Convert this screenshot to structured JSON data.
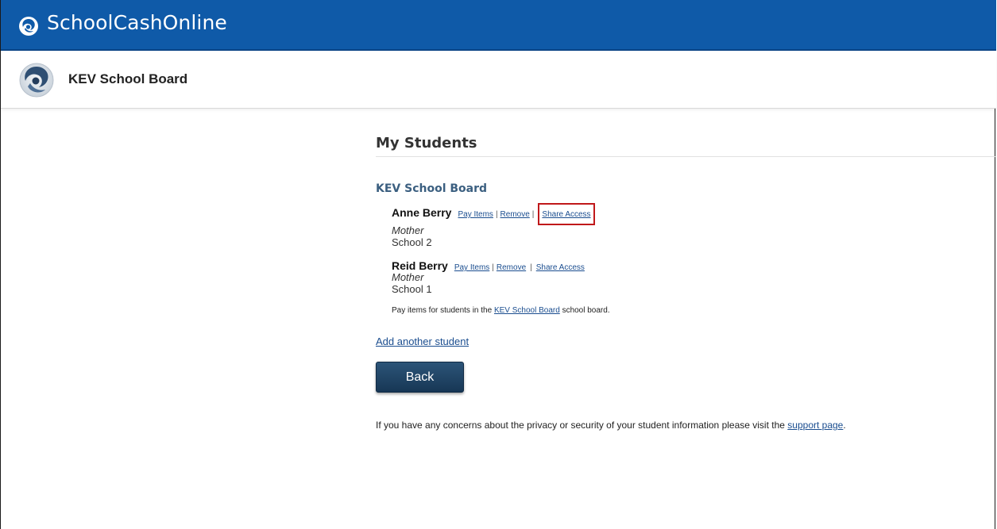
{
  "header": {
    "app_name": "SchoolCashOnline",
    "brand_color": "#0f5aa8",
    "logo_icon": "schoolcash-swirl-icon"
  },
  "board_bar": {
    "name": "KEV School Board",
    "logo_icon": "board-swirl-icon"
  },
  "main": {
    "title": "My Students",
    "section_title": "KEV School Board",
    "students": [
      {
        "name": "Anne Berry",
        "links": {
          "pay": "Pay Items",
          "remove": "Remove",
          "share": "Share Access"
        },
        "relation": "Mother",
        "school": "School 2",
        "share_highlighted": true
      },
      {
        "name": "Reid Berry",
        "links": {
          "pay": "Pay Items",
          "remove": "Remove",
          "share": "Share Access"
        },
        "relation": "Mother",
        "school": "School 1",
        "share_highlighted": false
      }
    ],
    "separator": "|",
    "pay_note": {
      "prefix": "Pay items for students in the",
      "link": "KEV School Board",
      "suffix": "school board."
    },
    "add_student_label": "Add another student",
    "back_label": "Back",
    "privacy": {
      "text": "If you have any concerns about the privacy or security of your student information please visit the",
      "link": "support page",
      "end": "."
    },
    "highlight_color": "#c0181a"
  }
}
